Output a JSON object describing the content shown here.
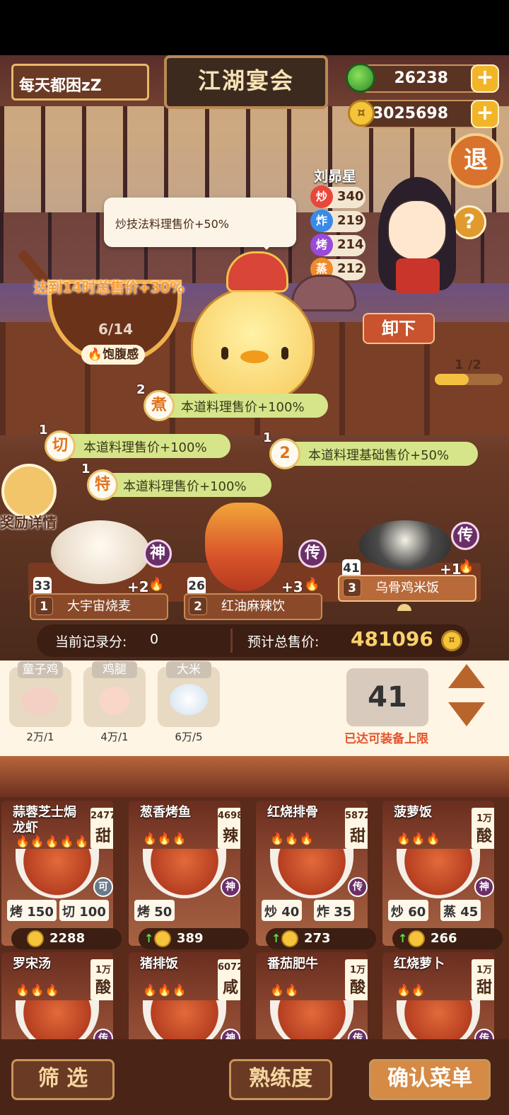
{
  "header": {
    "player_name": "每天都困zZ",
    "title": "江湖宴会",
    "jade": "26238",
    "coins": "3025698",
    "plus": "+",
    "exit_label": "退",
    "help_label": "?"
  },
  "chef": {
    "name": "刘昴星",
    "stats": [
      {
        "icon": "炒",
        "value": "340",
        "color": "#e8473a"
      },
      {
        "icon": "炸",
        "value": "219",
        "color": "#3a8ae8"
      },
      {
        "icon": "烤",
        "value": "214",
        "color": "#9a4ad8"
      },
      {
        "icon": "蒸",
        "value": "212",
        "color": "#f08a2a"
      }
    ],
    "unload_label": "卸下"
  },
  "tooltip": "炒技法料理售价+50%",
  "satiety": {
    "goal": "达到14时总售价+30%",
    "fill": "6/14",
    "label": "饱腹感"
  },
  "page_indicator": "1 /2",
  "buffs": [
    {
      "count": "2",
      "icon": "煮",
      "text": "本道料理售价+100%"
    },
    {
      "count": "1",
      "icon": "切",
      "text": "本道料理售价+100%"
    },
    {
      "count": "1",
      "icon": "2",
      "text": "本道料理基础售价+50%"
    },
    {
      "count": "1",
      "icon": "特",
      "text": "本道料理售价+100%"
    }
  ],
  "reward_label": "奖励详情",
  "selected_dishes": [
    {
      "slot": "1",
      "name": "大宇宙烧麦",
      "count": "33",
      "grade": "神",
      "bonus": "+2"
    },
    {
      "slot": "2",
      "name": "红油麻辣饮",
      "count": "26",
      "grade": "传",
      "bonus": "+3"
    },
    {
      "slot": "3",
      "name": "乌骨鸡米饭",
      "count": "41",
      "grade": "传",
      "bonus": "+1"
    }
  ],
  "score": {
    "record_label": "当前记录分:",
    "record_value": "0",
    "total_label": "预计总售价:",
    "total_value": "481096"
  },
  "ingredients": [
    {
      "name": "童子鸡",
      "count": "2万/1"
    },
    {
      "name": "鸡腿",
      "count": "4万/1"
    },
    {
      "name": "大米",
      "count": "6万/5"
    }
  ],
  "quantity": "41",
  "limit_text": "已达可装备上限",
  "recipes": [
    {
      "name": "蒜蓉芝士焗龙虾",
      "num": "2477",
      "taste": "甜",
      "flames": "🔥🔥🔥🔥🔥",
      "skills": [
        {
          "k": "烤",
          "v": "150"
        },
        {
          "k": "切",
          "v": "100"
        }
      ],
      "rank": "可",
      "price": "2288",
      "up": ""
    },
    {
      "name": "葱香烤鱼",
      "num": "4698",
      "taste": "辣",
      "flames": "🔥🔥🔥",
      "skills": [
        {
          "k": "烤",
          "v": "50"
        }
      ],
      "rank": "神",
      "price": "389",
      "up": "↑"
    },
    {
      "name": "红烧排骨",
      "num": "5872",
      "taste": "甜",
      "flames": "🔥🔥🔥",
      "skills": [
        {
          "k": "炒",
          "v": "40"
        },
        {
          "k": "炸",
          "v": "35"
        }
      ],
      "rank": "传",
      "price": "273",
      "up": "↑"
    },
    {
      "name": "菠萝饭",
      "num": "1万",
      "taste": "酸",
      "flames": "🔥🔥🔥",
      "skills": [
        {
          "k": "炒",
          "v": "60"
        },
        {
          "k": "蒸",
          "v": "45"
        }
      ],
      "rank": "神",
      "price": "266",
      "up": "↑"
    },
    {
      "name": "罗宋汤",
      "num": "1万",
      "taste": "酸",
      "flames": "🔥🔥🔥",
      "rank": "传"
    },
    {
      "name": "猪排饭",
      "num": "6072",
      "taste": "咸",
      "flames": "🔥🔥🔥",
      "rank": "神"
    },
    {
      "name": "番茄肥牛",
      "num": "1万",
      "taste": "酸",
      "flames": "🔥🔥",
      "rank": "传"
    },
    {
      "name": "红烧萝卜",
      "num": "1万",
      "taste": "甜",
      "flames": "🔥🔥",
      "rank": "传"
    }
  ],
  "buttons": {
    "filter": "筛 选",
    "proficiency": "熟练度",
    "confirm": "确认菜单"
  }
}
